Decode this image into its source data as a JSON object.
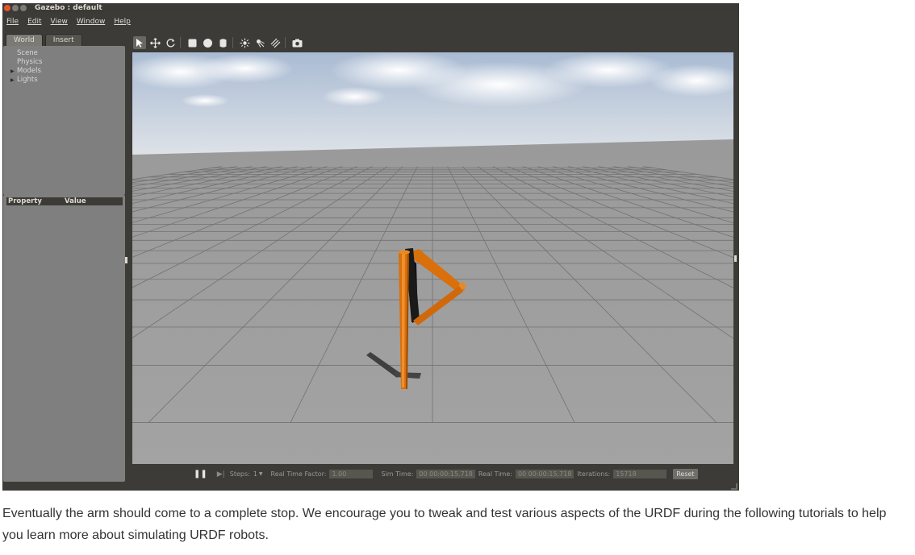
{
  "window": {
    "title": "Gazebo : default"
  },
  "menu": [
    "File",
    "Edit",
    "View",
    "Window",
    "Help"
  ],
  "left_panel": {
    "tabs": [
      "World",
      "Insert"
    ],
    "tree": [
      "Scene",
      "Physics",
      "Models",
      "Lights"
    ],
    "property_header": {
      "property": "Property",
      "value": "Value"
    }
  },
  "toolbar": {
    "tools": [
      "select-arrow-icon",
      "translate-icon",
      "rotate-icon",
      "box-icon",
      "sphere-icon",
      "cylinder-icon",
      "point-light-icon",
      "spot-light-icon",
      "directional-light-icon",
      "screenshot-icon"
    ]
  },
  "bottom_bar": {
    "steps_label": "Steps:",
    "steps_value": "1",
    "rtf_label": "Real Time Factor:",
    "rtf_value": "1.00",
    "sim_time_label": "Sim Time:",
    "sim_time_value": "00 00:00:15.718",
    "real_time_label": "Real Time:",
    "real_time_value": "00 00:00:15.718",
    "iterations_label": "Iterations:",
    "iterations_value": "15718",
    "reset_label": "Reset"
  },
  "caption": "Eventually the arm should come to a complete stop. We encourage you to tweak and test various aspects of the URDF during the following tutorials to help you learn more about simulating URDF robots.",
  "colors": {
    "link_orange": "#d9700c",
    "sky_top": "#aabcd5",
    "ground": "#9e9e9e"
  }
}
